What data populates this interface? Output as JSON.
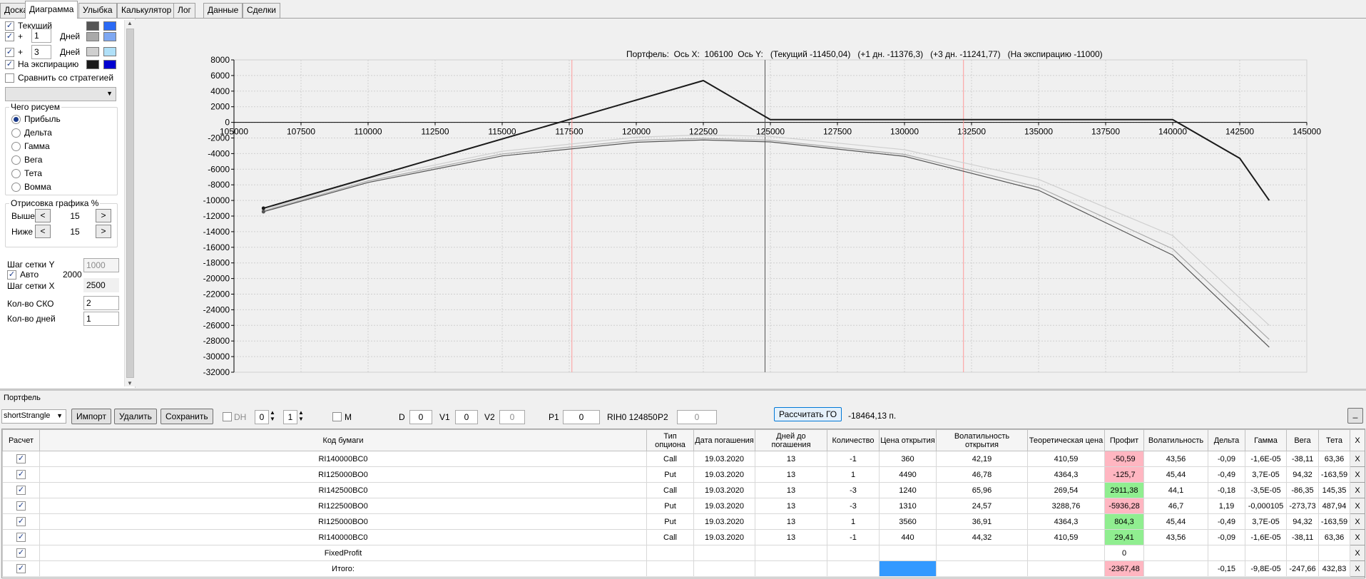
{
  "tabs": [
    "Доска",
    "Диаграмма",
    "Улыбка",
    "Калькулятор",
    "Лог",
    "Данные",
    "Сделки"
  ],
  "active_tab": "Диаграмма",
  "left_panel": {
    "current_label": "Текущий",
    "plus": "+",
    "days_label": "Дней",
    "days1": "1",
    "days2": "3",
    "expiry_label": "На экспирацию",
    "compare_label": "Сравнить со стратегией",
    "compare_select_value": "",
    "draw_group_title": "Чего рисуем",
    "draw_options": [
      "Прибыль",
      "Дельта",
      "Гамма",
      "Вега",
      "Тета",
      "Вомма"
    ],
    "draw_selected": "Прибыль",
    "render_group_title": "Отрисовка графика %",
    "above_label": "Выше",
    "above_value": "15",
    "below_label": "Ниже",
    "below_value": "15",
    "spin_left": "<",
    "spin_right": ">",
    "grid_step_y_label": "Шаг сетки Y",
    "grid_step_y_value": "1000",
    "auto_label": "Авто",
    "auto_value": "2000",
    "grid_step_x_label": "Шаг сетки X",
    "grid_step_x_value": "2500",
    "sko_label": "Кол-во СКО",
    "sko_value": "2",
    "days_count_label": "Кол-во дней",
    "days_count_value": "1",
    "colors": {
      "current_dark": "#555555",
      "current_light": "#2b6af5",
      "d1_dark": "#a9a9a9",
      "d1_light": "#7fa8f2",
      "d3_dark": "#cfcfcf",
      "d3_light": "#b0e0f8",
      "expiry_dark": "#1a1a1a",
      "expiry_light": "#0000d0"
    }
  },
  "chart_data": {
    "type": "line",
    "title": "Портфель:  Ось X:  106100  Ось Y:   (Текущий -11450,04)   (+1 дн. -11376,3)   (+3 дн. -11241,77)   (На экспирацию -11000)",
    "x_ticks": [
      105000,
      107500,
      110000,
      112500,
      115000,
      117500,
      120000,
      122500,
      125000,
      127500,
      130000,
      132500,
      135000,
      137500,
      140000,
      142500,
      145000
    ],
    "y_ticks": [
      8000,
      6000,
      4000,
      2000,
      0,
      -2000,
      -4000,
      -6000,
      -8000,
      -10000,
      -12000,
      -14000,
      -16000,
      -18000,
      -20000,
      -22000,
      -24000,
      -26000,
      -28000,
      -30000,
      -32000
    ],
    "xlim": [
      105000,
      145000
    ],
    "ylim": [
      -32000,
      8000
    ],
    "vlines": [
      {
        "x": 117600,
        "color": "#ff9a9a"
      },
      {
        "x": 124800,
        "color": "#555555"
      },
      {
        "x": 132200,
        "color": "#ff9a9a"
      }
    ],
    "series": [
      {
        "name": "На экспирацию",
        "color": "#1a1a1a",
        "width": 2,
        "x": [
          106100,
          122500,
          125000,
          140000,
          142500,
          143600
        ],
        "y": [
          -11000,
          5350,
          350,
          350,
          -4600,
          -10000
        ]
      },
      {
        "name": "Текущий",
        "color": "#555555",
        "width": 1.2,
        "x": [
          106100,
          110000,
          115000,
          120000,
          122500,
          125000,
          130000,
          135000,
          140000,
          143600
        ],
        "y": [
          -11450,
          -7700,
          -4300,
          -2550,
          -2250,
          -2500,
          -4350,
          -8700,
          -17000,
          -28800
        ]
      },
      {
        "name": "+1 дн.",
        "color": "#a9a9a9",
        "width": 1.2,
        "x": [
          106100,
          110000,
          115000,
          120000,
          122500,
          125000,
          130000,
          135000,
          140000,
          143600
        ],
        "y": [
          -11376,
          -7500,
          -4050,
          -2300,
          -2050,
          -2300,
          -4100,
          -8300,
          -16200,
          -27800
        ]
      },
      {
        "name": "+3 дн.",
        "color": "#cfcfcf",
        "width": 1.2,
        "x": [
          106100,
          110000,
          115000,
          120000,
          122500,
          125000,
          130000,
          135000,
          140000,
          143600
        ],
        "y": [
          -11242,
          -7200,
          -3700,
          -1900,
          -1600,
          -1800,
          -3500,
          -7300,
          -14500,
          -26000
        ]
      }
    ]
  },
  "portfolio": {
    "label": "Портфель",
    "strategy_value": "shortStrangle",
    "import_label": "Импорт",
    "delete_label": "Удалить",
    "save_label": "Сохранить",
    "dh_label": "DH",
    "spin1_value": "0",
    "spin2_value": "1",
    "m_label": "M",
    "d_label": "D",
    "d_value": "0",
    "v1_label": "V1",
    "v1_value": "0",
    "v2_label": "V2",
    "v2_value": "0",
    "p1_label": "P1",
    "p1_value": "0",
    "rih_text": "RIH0 124850",
    "p2_label": "P2",
    "p2_value": "0",
    "calc_go_label": "Рассчитать ГО",
    "go_value": "-18464,13 п.",
    "corner_button": "_"
  },
  "table": {
    "headers": [
      "Расчет",
      "Код бумаги",
      "Тип опциона",
      "Дата погашения",
      "Дней до погашения",
      "Количество",
      "Цена открытия",
      "Волатильность открытия",
      "Теоретическая цена",
      "Профит",
      "Волатильность",
      "Дельта",
      "Гамма",
      "Вега",
      "Тета",
      "X"
    ],
    "rows": [
      {
        "code": "RI140000BC0",
        "type": "Call",
        "date": "19.03.2020",
        "days": "13",
        "qty": "-1",
        "price": "360",
        "vol_open": "42,19",
        "theo": "410,59",
        "profit": "-50,59",
        "profit_class": "neg",
        "vol": "43,56",
        "delta": "-0,09",
        "gamma": "-1,6E-05",
        "vega": "-38,11",
        "theta": "63,36",
        "x": "X"
      },
      {
        "code": "RI125000BO0",
        "type": "Put",
        "date": "19.03.2020",
        "days": "13",
        "qty": "1",
        "price": "4490",
        "vol_open": "46,78",
        "theo": "4364,3",
        "profit": "-125,7",
        "profit_class": "neg",
        "vol": "45,44",
        "delta": "-0,49",
        "gamma": "3,7E-05",
        "vega": "94,32",
        "theta": "-163,59",
        "x": "X"
      },
      {
        "code": "RI142500BC0",
        "type": "Call",
        "date": "19.03.2020",
        "days": "13",
        "qty": "-3",
        "price": "1240",
        "vol_open": "65,96",
        "theo": "269,54",
        "profit": "2911,38",
        "profit_class": "pos",
        "vol": "44,1",
        "delta": "-0,18",
        "gamma": "-3,5E-05",
        "vega": "-86,35",
        "theta": "145,35",
        "x": "X"
      },
      {
        "code": "RI122500BO0",
        "type": "Put",
        "date": "19.03.2020",
        "days": "13",
        "qty": "-3",
        "price": "1310",
        "vol_open": "24,57",
        "theo": "3288,76",
        "profit": "-5936,28",
        "profit_class": "neg",
        "vol": "46,7",
        "delta": "1,19",
        "gamma": "-0,000105",
        "vega": "-273,73",
        "theta": "487,94",
        "x": "X"
      },
      {
        "code": "RI125000BO0",
        "type": "Put",
        "date": "19.03.2020",
        "days": "13",
        "qty": "1",
        "price": "3560",
        "vol_open": "36,91",
        "theo": "4364,3",
        "profit": "804,3",
        "profit_class": "pos",
        "vol": "45,44",
        "delta": "-0,49",
        "gamma": "3,7E-05",
        "vega": "94,32",
        "theta": "-163,59",
        "x": "X"
      },
      {
        "code": "RI140000BC0",
        "type": "Call",
        "date": "19.03.2020",
        "days": "13",
        "qty": "-1",
        "price": "440",
        "vol_open": "44,32",
        "theo": "410,59",
        "profit": "29,41",
        "profit_class": "pos",
        "vol": "43,56",
        "delta": "-0,09",
        "gamma": "-1,6E-05",
        "vega": "-38,11",
        "theta": "63,36",
        "x": "X"
      },
      {
        "code": "FixedProfit",
        "type": "",
        "date": "",
        "days": "",
        "qty": "",
        "price": "",
        "vol_open": "",
        "theo": "",
        "profit": "0",
        "profit_class": "",
        "vol": "",
        "delta": "",
        "gamma": "",
        "vega": "",
        "theta": "",
        "x": "X"
      },
      {
        "code": "Итого:",
        "type": "",
        "date": "",
        "days": "",
        "qty": "",
        "price": "",
        "price_class": "bluecell",
        "vol_open": "",
        "theo": "",
        "profit": "-2367,48",
        "profit_class": "neg",
        "vol": "",
        "delta": "-0,15",
        "gamma": "-9,8E-05",
        "vega": "-247,66",
        "theta": "432,83",
        "x": "X"
      }
    ]
  }
}
